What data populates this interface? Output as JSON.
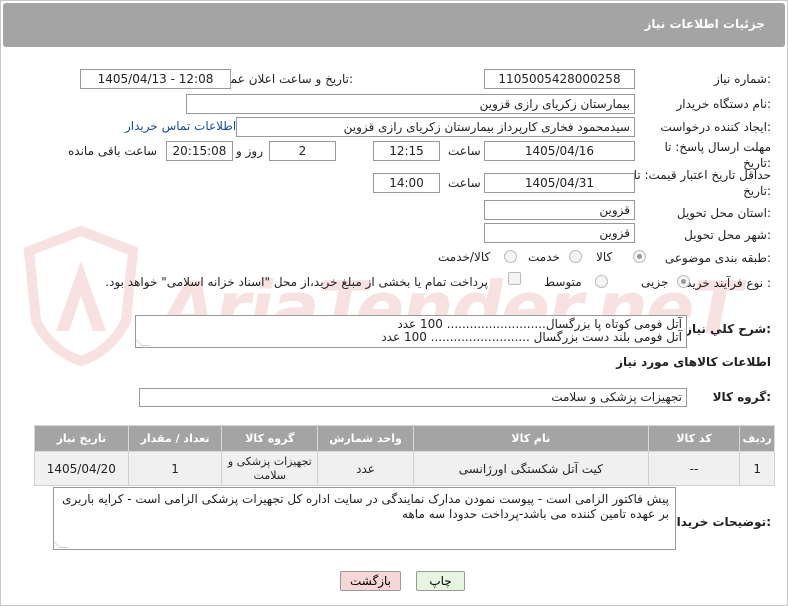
{
  "header": {
    "title": "جزئیات اطلاعات نیاز"
  },
  "labels": {
    "need_number": "شماره نیاز:",
    "announce_datetime": "تاریخ و ساعت اعلان عمومی:",
    "buyer_org": "نام دستگاه خریدار:",
    "requester": "ایجاد کننده درخواست:",
    "reply_deadline": "مهلت ارسال پاسخ: تا تاریخ:",
    "price_validity": "حداقل تاریخ اعتبار قیمت: تا تاریخ:",
    "delivery_province": "استان محل تحویل:",
    "delivery_city": "شهر محل تحویل:",
    "category": "طبقه بندی موضوعی:",
    "process_type": "نوع فرآیند خرید :",
    "description": "شرح کلي نياز:",
    "goods_info": "اطلاعات کالاهای مورد نیاز",
    "goods_group": "گروه کالا:",
    "buyer_notes": "توضیحات خریدار:",
    "time": "ساعت",
    "day_and": "روز و",
    "hours_left": "ساعت باقی مانده"
  },
  "fields": {
    "need_number": "1105005428000258",
    "announce_datetime": "1405/04/13 - 12:08",
    "buyer_org": "بیمارستان زکریای رازی قزوین",
    "requester": "سیدمحمود فخاری کارپرداز بیمارستان زکریای رازی قزوین",
    "buyer_contact_link": "اطلاعات تماس خریدار",
    "reply_date": "1405/04/16",
    "reply_time": "12:15",
    "reply_days": "2",
    "reply_remaining": "20:15:08",
    "price_date": "1405/04/31",
    "price_time": "14:00",
    "province": "قزوین",
    "city": "قزوین",
    "goods_group": "تجهیزات پزشکی و سلامت"
  },
  "category_options": [
    {
      "label": "کالا",
      "selected": true
    },
    {
      "label": "خدمت",
      "selected": false
    },
    {
      "label": "کالا/خدمت",
      "selected": false
    }
  ],
  "process_options": [
    {
      "label": "جزیی",
      "selected": true
    },
    {
      "label": "متوسط",
      "selected": false
    }
  ],
  "payment_note": "پرداخت تمام یا بخشی از مبلغ خرید،از محل \"اسناد خزانه اسلامی\" خواهد بود.",
  "description_lines": [
    "آتل فومی کوتاه پا بزرگسال.......................... 100 عدد",
    "آتل فومی بلند دست بزرگسال .......................... 100 عدد"
  ],
  "table": {
    "headers": [
      "ردیف",
      "کد کالا",
      "نام کالا",
      "واحد شمارش",
      "گروه کالا",
      "تعداد / مقدار",
      "تاریخ نیاز"
    ],
    "rows": [
      [
        "1",
        "--",
        "کیت آتل شکستگی اورژانسی",
        "عدد",
        "تجهیزات پزشکی و سلامت",
        "1",
        "1405/04/20"
      ]
    ]
  },
  "buyer_notes_text": "پیش فاکتور الزامی است - پیوست نمودن مدارک نمایندگی در سایت اداره کل تجهیزات پزشکی الزامی است - کرایه باربری بر عهده تامین کننده می باشد-پرداخت حدودا سه ماهه",
  "buttons": {
    "print": "چاپ",
    "back": "بازگشت"
  },
  "watermark": {
    "text": "AriaTender.neT"
  },
  "colors": {
    "header_bg": "#a4a4a4",
    "link": "#1a4f9c",
    "back_button": "#f7d6d6",
    "print_button": "#e6f5e0"
  }
}
